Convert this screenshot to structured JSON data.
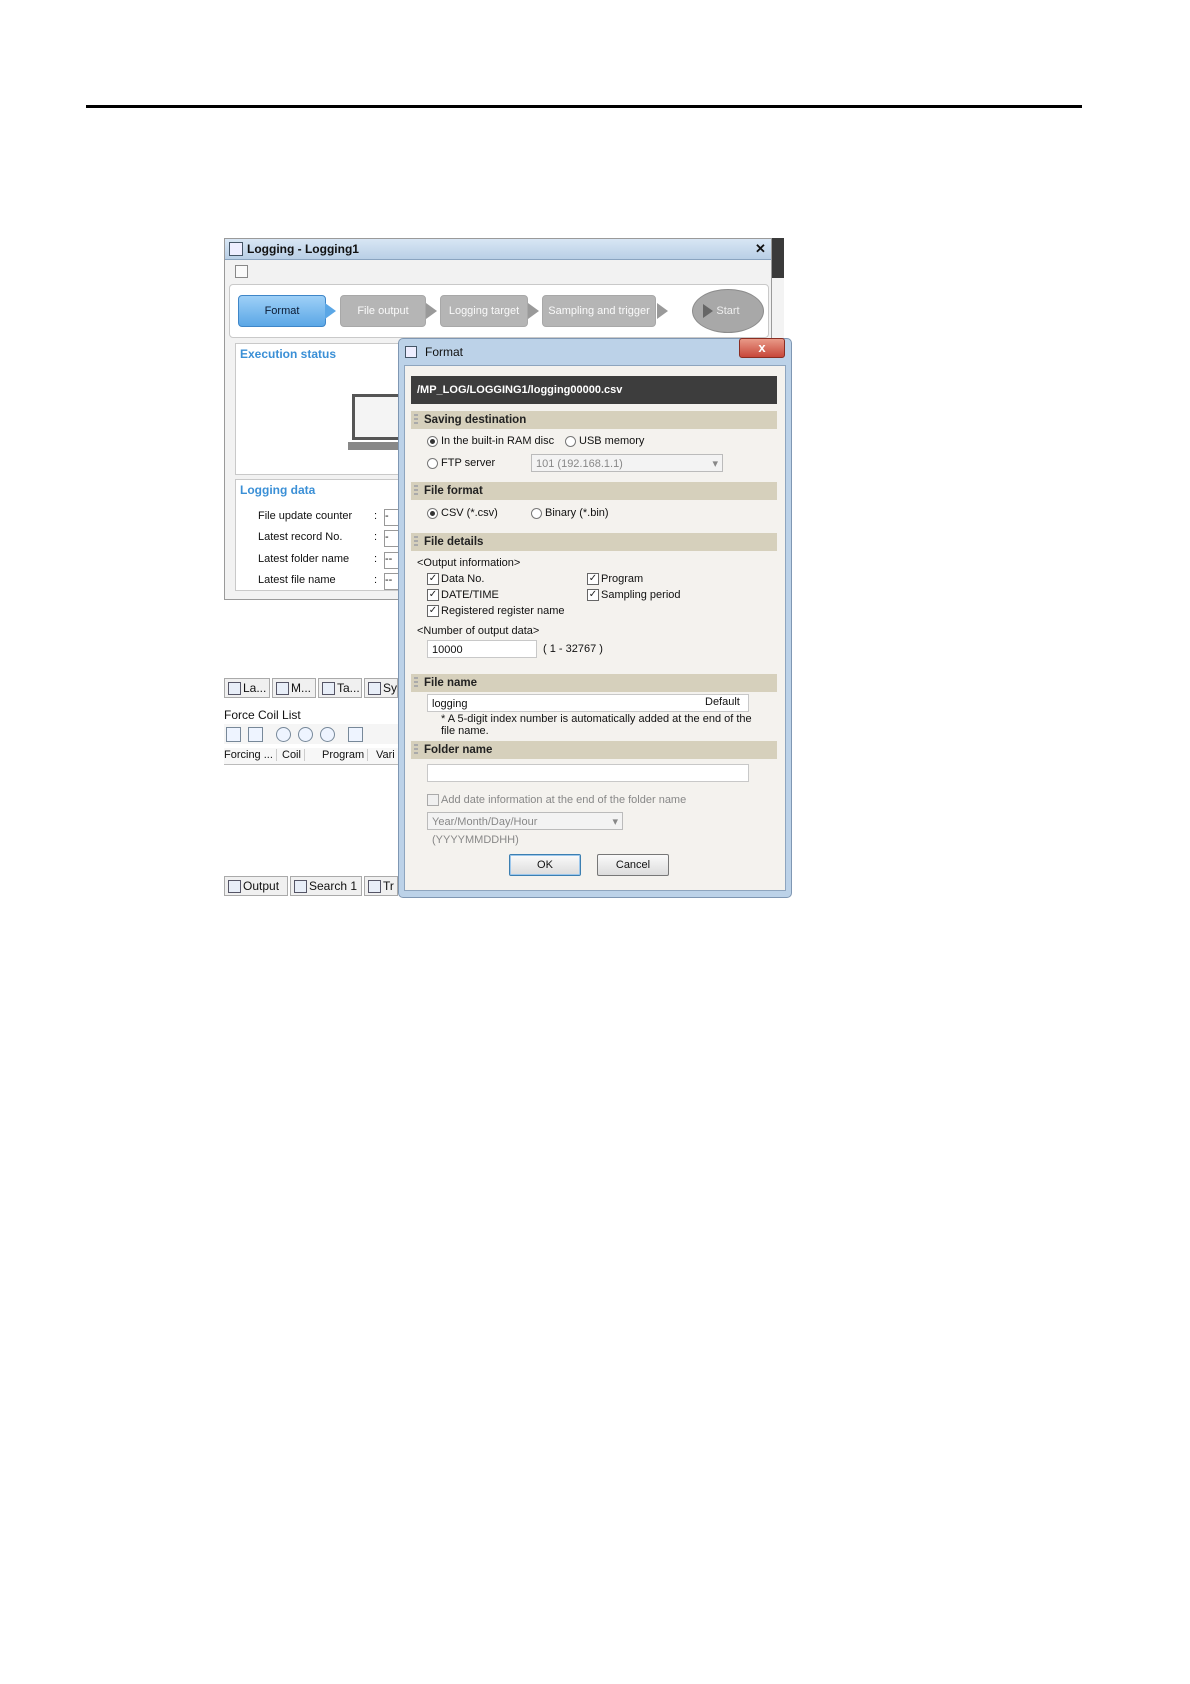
{
  "logging_window": {
    "title": "Logging - Logging1",
    "close": "✕",
    "steps": [
      "Format",
      "File output",
      "Logging target",
      "Sampling and trigger"
    ],
    "start": "Start",
    "execution_status": "Execution status",
    "logging_data": {
      "heading": "Logging data",
      "rows": [
        "File update counter",
        "Latest record No.",
        "Latest folder name",
        "Latest file name"
      ],
      "colon": ":",
      "values": [
        "-",
        "-",
        "--",
        "--"
      ]
    }
  },
  "bottom_panel": {
    "tabs": [
      "La...",
      "M...",
      "Ta...",
      "Sy"
    ],
    "title": "Force Coil List",
    "columns": [
      "Forcing ...",
      "Coil",
      "Program",
      "Vari"
    ],
    "output_tabs": [
      "Output",
      "Search 1",
      "Tr"
    ]
  },
  "dialog": {
    "title": "Format",
    "close": "x",
    "path": "/MP_LOG/LOGGING1/logging00000.csv",
    "saving_destination": {
      "heading": "Saving destination",
      "ram": "In the built-in RAM disc",
      "usb": "USB memory",
      "ftp": "FTP server",
      "ftp_select": "101 (192.168.1.1)"
    },
    "file_format": {
      "heading": "File format",
      "csv": "CSV (*.csv)",
      "binary": "Binary (*.bin)"
    },
    "file_details": {
      "heading": "File details",
      "output_information": "<Output information>",
      "data_no": "Data No.",
      "program": "Program",
      "date_time": "DATE/TIME",
      "sampling_period": "Sampling period",
      "registered_name": "Registered register name",
      "number_label": "<Number of output data>",
      "number_value": "10000",
      "number_range": "( 1 - 32767 )",
      "check": "✓"
    },
    "file_name": {
      "heading": "File name",
      "value": "logging",
      "default": "Default",
      "note1": "* A 5-digit index number is automatically added at the end of the",
      "note2": "file name."
    },
    "folder_name": {
      "heading": "Folder name",
      "value": "",
      "add_date": "Add date information at the end of the folder name",
      "date_format": "Year/Month/Day/Hour (YYYYMMDDHH)"
    },
    "ok": "OK",
    "cancel": "Cancel"
  }
}
